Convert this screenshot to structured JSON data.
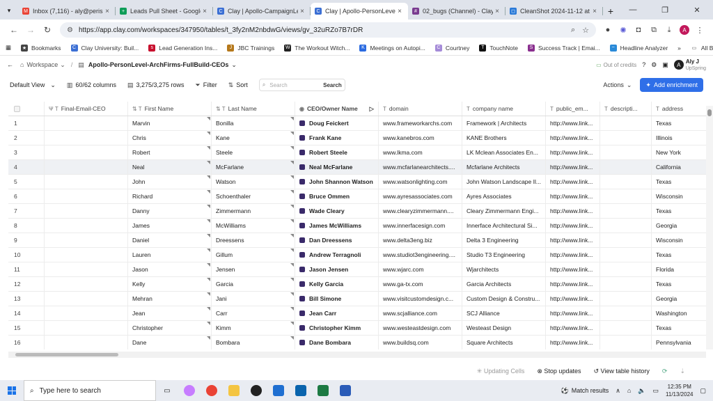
{
  "browser": {
    "tabs": [
      {
        "title": "Inbox (7,116) - aly@perissi",
        "color": "#ea4335",
        "glyph": "M"
      },
      {
        "title": "Leads Pull Sheet - Google S",
        "color": "#0f9d58",
        "glyph": "+"
      },
      {
        "title": "Clay | Apollo-CampaignLev",
        "color": "#3b6fd4",
        "glyph": "C"
      },
      {
        "title": "Clay | Apollo-PersonLevel-",
        "color": "#3b6fd4",
        "glyph": "C",
        "active": true
      },
      {
        "title": "02_bugs (Channel) - Clay -",
        "color": "#7a3b8f",
        "glyph": "#"
      },
      {
        "title": "CleanShot 2024-11-12 at",
        "color": "#2a7ad8",
        "glyph": "◻"
      }
    ],
    "url": "https://app.clay.com/workspaces/347950/tables/t_3fy2nM2nbdwG/views/gv_32uRZo7B7rDR",
    "account_initial": "A",
    "bookmarks": [
      {
        "label": "Bookmarks",
        "icon": "★",
        "color": "#444"
      },
      {
        "label": "Clay University: Buil...",
        "icon": "C",
        "color": "#3b6fd4"
      },
      {
        "label": "Lead Generation Ins...",
        "icon": "s",
        "color": "#c8102e"
      },
      {
        "label": "JBC Trainings",
        "icon": "J",
        "color": "#b5781b"
      },
      {
        "label": "The Workout Witch...",
        "icon": "W",
        "color": "#222"
      },
      {
        "label": "Meetings on Autopi...",
        "icon": "K",
        "color": "#2a6ae0"
      },
      {
        "label": "Courtney",
        "icon": "C",
        "color": "#a58bd8"
      },
      {
        "label": "TouchNote",
        "icon": "T",
        "color": "#111"
      },
      {
        "label": "Success Track | Emai...",
        "icon": "S",
        "color": "#8a2f8f"
      },
      {
        "label": "Headline Analyzer",
        "icon": "~",
        "color": "#2a8ad8"
      }
    ],
    "more_bookmarks": "»",
    "all_bookmarks": "All Bookmarks"
  },
  "clay": {
    "workspace": "Workspace",
    "table_name": "Apollo-PersonLevel-ArchFirms-FullBuild-CEOs",
    "credits": "Out of credits",
    "user_name": "Aly J",
    "user_org": "UpSpring",
    "user_initial": "A"
  },
  "toolbar": {
    "view": "Default View",
    "columns": "60/62 columns",
    "rows": "3,275/3,275 rows",
    "filter": "Filter",
    "sort": "Sort",
    "search_placeholder": "Search",
    "search_button": "Search",
    "actions": "Actions",
    "add_enrichment": "Add enrichment"
  },
  "table": {
    "columns": [
      "Final-Email-CEO",
      "First Name",
      "Last Name",
      "CEO/Owner Name",
      "domain",
      "company name",
      "public_em...",
      "descripti...",
      "address"
    ],
    "rows": [
      {
        "n": "1",
        "email": "",
        "first": "Marvin",
        "last": "Bonilla",
        "ceo": "Doug Feickert",
        "domain": "www.frameworkarchs.com",
        "company": "Framework | Architects",
        "public": "http://www.link...",
        "desc": "",
        "address": "Texas"
      },
      {
        "n": "2",
        "email": "",
        "first": "Chris",
        "last": "Kane",
        "ceo": "Frank Kane",
        "domain": "www.kanebros.com",
        "company": "KANE Brothers",
        "public": "http://www.link...",
        "desc": "",
        "address": "Illinois"
      },
      {
        "n": "3",
        "email": "",
        "first": "Robert",
        "last": "Steele",
        "ceo": "Robert Steele",
        "domain": "www.lkma.com",
        "company": "LK Mclean Associates En...",
        "public": "http://www.link...",
        "desc": "",
        "address": "New York"
      },
      {
        "n": "4",
        "email": "",
        "first": "Neal",
        "last": "McFarlane",
        "ceo": "Neal McFarlane",
        "domain": "www.mcfarlanearchitects....",
        "company": "Mcfarlane Architects",
        "public": "http://www.link...",
        "desc": "",
        "address": "California"
      },
      {
        "n": "5",
        "email": "",
        "first": "John",
        "last": "Watson",
        "ceo": "John Shannon Watson",
        "domain": "www.watsonlighting.com",
        "company": "John Watson Landscape Il...",
        "public": "http://www.link...",
        "desc": "",
        "address": "Texas"
      },
      {
        "n": "6",
        "email": "",
        "first": "Richard",
        "last": "Schoenthaler",
        "ceo": "Bruce Ommen",
        "domain": "www.ayresassociates.com",
        "company": "Ayres Associates",
        "public": "http://www.link...",
        "desc": "",
        "address": "Wisconsin"
      },
      {
        "n": "7",
        "email": "",
        "first": "Danny",
        "last": "Zimmermann",
        "ceo": "Wade Cleary",
        "domain": "www.clearyzimmermann....",
        "company": "Cleary Zimmermann Engi...",
        "public": "http://www.link...",
        "desc": "",
        "address": "Texas"
      },
      {
        "n": "8",
        "email": "",
        "first": "James",
        "last": "McWilliams",
        "ceo": "James McWilliams",
        "domain": "www.innerfacesign.com",
        "company": "Innerface Architectural Si...",
        "public": "http://www.link...",
        "desc": "",
        "address": "Georgia"
      },
      {
        "n": "9",
        "email": "",
        "first": "Daniel",
        "last": "Dreessens",
        "ceo": "Dan Dreessens",
        "domain": "www.delta3eng.biz",
        "company": "Delta 3 Engineering",
        "public": "http://www.link...",
        "desc": "",
        "address": "Wisconsin"
      },
      {
        "n": "10",
        "email": "",
        "first": "Lauren",
        "last": "Gillum",
        "ceo": "Andrew Terragnoli",
        "domain": "www.studiot3engineering....",
        "company": "Studio T3 Engineering",
        "public": "http://www.link...",
        "desc": "",
        "address": "Texas"
      },
      {
        "n": "11",
        "email": "",
        "first": "Jason",
        "last": "Jensen",
        "ceo": "Jason Jensen",
        "domain": "www.wjarc.com",
        "company": "Wjarchitects",
        "public": "http://www.link...",
        "desc": "",
        "address": "Florida"
      },
      {
        "n": "12",
        "email": "",
        "first": "Kelly",
        "last": "Garcia",
        "ceo": "Kelly Garcia",
        "domain": "www.ga-tx.com",
        "company": "Garcia Architects",
        "public": "http://www.link...",
        "desc": "",
        "address": "Texas"
      },
      {
        "n": "13",
        "email": "",
        "first": "Mehran",
        "last": "Jani",
        "ceo": "Bill Simone",
        "domain": "www.visitcustomdesign.c...",
        "company": "Custom Design & Constru...",
        "public": "http://www.link...",
        "desc": "",
        "address": "Georgia"
      },
      {
        "n": "14",
        "email": "",
        "first": "Jean",
        "last": "Carr",
        "ceo": "Jean Carr",
        "domain": "www.scjalliance.com",
        "company": "SCJ Alliance",
        "public": "http://www.link...",
        "desc": "",
        "address": "Washington"
      },
      {
        "n": "15",
        "email": "",
        "first": "Christopher",
        "last": "Kimm",
        "ceo": "Christopher Kimm",
        "domain": "www.westeastdesign.com",
        "company": "Westeast Design",
        "public": "http://www.link...",
        "desc": "",
        "address": "Texas"
      },
      {
        "n": "16",
        "email": "",
        "first": "Dane",
        "last": "Bombara",
        "ceo": "Dane Bombara",
        "domain": "www.buildsq.com",
        "company": "Square Architects",
        "public": "http://www.link...",
        "desc": "",
        "address": "Pennsylvania"
      }
    ],
    "highlighted_row": "4"
  },
  "footer": {
    "updating": "Updating Cells",
    "stop": "Stop updates",
    "history": "View table history"
  },
  "taskbar": {
    "search_placeholder": "Type here to search",
    "match_results": "Match results",
    "time": "12:35 PM",
    "date": "11/13/2024"
  }
}
